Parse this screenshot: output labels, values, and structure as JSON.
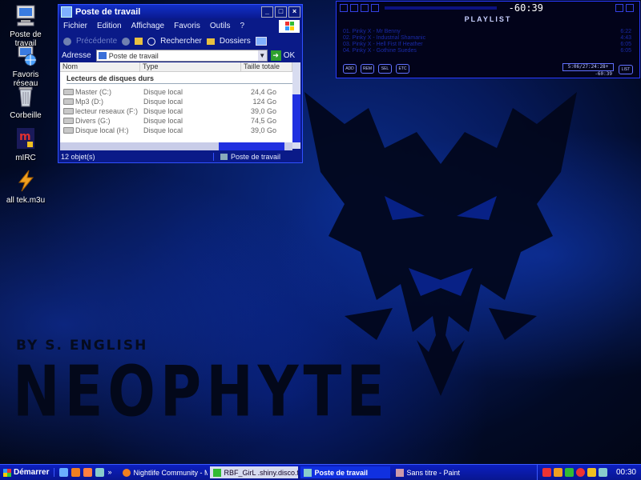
{
  "desktop": {
    "icons": [
      {
        "label": "Poste de travail"
      },
      {
        "label": "Favoris réseau"
      },
      {
        "label": "Corbeille"
      },
      {
        "label": "mIRC"
      },
      {
        "label": "all tek.m3u"
      }
    ],
    "wallpaper": {
      "byline": "BY S. ENGLISH",
      "title": "NEOPHYTE"
    }
  },
  "explorer": {
    "title": "Poste de travail",
    "menu": [
      "Fichier",
      "Edition",
      "Affichage",
      "Favoris",
      "Outils",
      "?"
    ],
    "toolbar": {
      "back": "Précédente",
      "search": "Rechercher",
      "folders": "Dossiers"
    },
    "address": {
      "label": "Adresse",
      "value": "Poste de travail",
      "go": "OK"
    },
    "columns": [
      "Nom",
      "Type",
      "Taille totale"
    ],
    "group": "Lecteurs de disques durs",
    "drives": [
      {
        "name": "Master (C:)",
        "type": "Disque local",
        "size": "24,4 Go"
      },
      {
        "name": "Mp3 (D:)",
        "type": "Disque local",
        "size": "124 Go"
      },
      {
        "name": "lecteur reseaux (F:)",
        "type": "Disque local",
        "size": "39,0 Go"
      },
      {
        "name": "Divers (G:)",
        "type": "Disque local",
        "size": "74,5 Go"
      },
      {
        "name": "Disque local (H:)",
        "type": "Disque local",
        "size": "39,0 Go"
      }
    ],
    "status": {
      "count": "12 objet(s)",
      "location": "Poste de travail"
    }
  },
  "winamp": {
    "time": "-60:39",
    "title": "PLAYLIST",
    "tracks": [
      {
        "name": "01. Pinky X - Mr Benny",
        "duration": "6:22"
      },
      {
        "name": "02. Pinky X - Industrial Shamanic",
        "duration": "4:43"
      },
      {
        "name": "03. Pinky X - Hell Fist If Heather",
        "duration": "6:05"
      },
      {
        "name": "04. Pinky X - Gothine Suedes",
        "duration": "6:05"
      }
    ],
    "buttons": [
      "ADD",
      "REM",
      "SEL",
      "ETC"
    ],
    "lcd": "5:06/27:24:28+",
    "lcd_time": "-60:39",
    "list_button": "LIST"
  },
  "taskbar": {
    "start": "Démarrer",
    "tasks": [
      {
        "label": "Nightlife Community - Mo..."
      },
      {
        "label": "RBF_GirL .shiny.disco.fr..."
      },
      {
        "label": "Poste de travail"
      },
      {
        "label": "Sans titre - Paint"
      }
    ],
    "clock": "00:30"
  }
}
